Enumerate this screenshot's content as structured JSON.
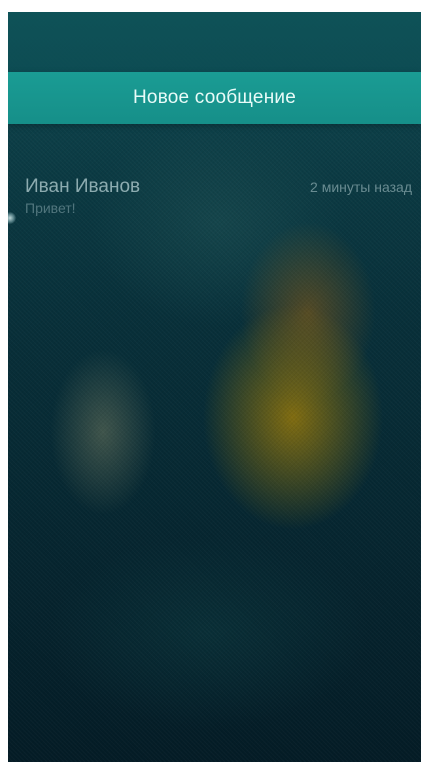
{
  "header": {
    "title": "Новое сообщение"
  },
  "messages": [
    {
      "sender": "Иван Иванов",
      "time": "2 минуты назад",
      "preview": "Привет!"
    }
  ]
}
